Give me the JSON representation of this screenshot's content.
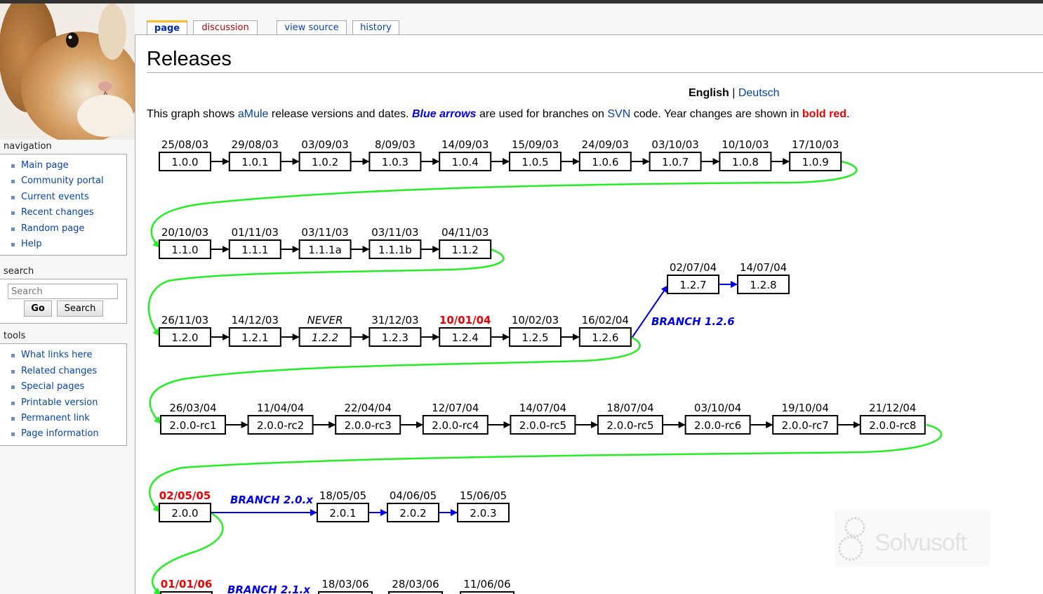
{
  "page": {
    "title": "Releases",
    "tabs": {
      "page": "page",
      "discussion": "discussion",
      "view_source": "view source",
      "history": "history"
    },
    "lang": {
      "english": "English",
      "separator": "|",
      "deutsch": "Deutsch"
    },
    "intro": {
      "p1": "This graph shows ",
      "amule": "aMule",
      "p2": " release versions and dates. ",
      "blue_arrows": "Blue arrows",
      "p3": " are used for branches on ",
      "svn": "SVN",
      "p4": " code. Year changes are shown in ",
      "bold_red": "bold red",
      "p5": "."
    }
  },
  "sidebar": {
    "navigation": {
      "heading": "navigation",
      "items": [
        "Main page",
        "Community portal",
        "Current events",
        "Recent changes",
        "Random page",
        "Help"
      ]
    },
    "search": {
      "heading": "search",
      "placeholder": "Search",
      "go": "Go",
      "search": "Search"
    },
    "tools": {
      "heading": "tools",
      "items": [
        "What links here",
        "Related changes",
        "Special pages",
        "Printable version",
        "Permanent link",
        "Page information"
      ]
    }
  },
  "watermark": {
    "text": "Solvusoft"
  },
  "colors": {
    "link": "#0645ad",
    "branch": "#0000ee",
    "year_change": "#ee0000",
    "wrap_arrow": "#22ee22"
  },
  "graph": {
    "rows": [
      {
        "nodes": [
          {
            "v": "1.0.0",
            "d": "25/08/03"
          },
          {
            "v": "1.0.1",
            "d": "29/08/03"
          },
          {
            "v": "1.0.2",
            "d": "03/09/03"
          },
          {
            "v": "1.0.3",
            "d": "8/09/03"
          },
          {
            "v": "1.0.4",
            "d": "14/09/03"
          },
          {
            "v": "1.0.5",
            "d": "15/09/03"
          },
          {
            "v": "1.0.6",
            "d": "24/09/03"
          },
          {
            "v": "1.0.7",
            "d": "03/10/03"
          },
          {
            "v": "1.0.8",
            "d": "10/10/03"
          },
          {
            "v": "1.0.9",
            "d": "17/10/03"
          }
        ]
      },
      {
        "nodes": [
          {
            "v": "1.1.0",
            "d": "20/10/03"
          },
          {
            "v": "1.1.1",
            "d": "01/11/03"
          },
          {
            "v": "1.1.1a",
            "d": "03/11/03"
          },
          {
            "v": "1.1.1b",
            "d": "03/11/03"
          },
          {
            "v": "1.1.2",
            "d": "04/11/03"
          }
        ]
      },
      {
        "nodes": [
          {
            "v": "1.2.0",
            "d": "26/11/03"
          },
          {
            "v": "1.2.1",
            "d": "14/12/03"
          },
          {
            "v": "1.2.2",
            "d": "NEVER",
            "italic": true
          },
          {
            "v": "1.2.3",
            "d": "31/12/03"
          },
          {
            "v": "1.2.4",
            "d": "10/01/04",
            "year": true
          },
          {
            "v": "1.2.5",
            "d": "10/02/03"
          },
          {
            "v": "1.2.6",
            "d": "16/02/04"
          }
        ]
      },
      {
        "nodes": [
          {
            "v": "2.0.0-rc1",
            "d": "26/03/04"
          },
          {
            "v": "2.0.0-rc2",
            "d": "11/04/04"
          },
          {
            "v": "2.0.0-rc3",
            "d": "22/04/04"
          },
          {
            "v": "2.0.0-rc4",
            "d": "12/07/04"
          },
          {
            "v": "2.0.0-rc5",
            "d": "14/07/04"
          },
          {
            "v": "2.0.0-rc5",
            "d": "18/07/04"
          },
          {
            "v": "2.0.0-rc6",
            "d": "03/10/04"
          },
          {
            "v": "2.0.0-rc7",
            "d": "19/10/04"
          },
          {
            "v": "2.0.0-rc8",
            "d": "21/12/04"
          }
        ]
      },
      {
        "nodes": [
          {
            "v": "2.0.0",
            "d": "02/05/05",
            "year": true
          }
        ]
      },
      {
        "nodes": [
          {
            "v": "",
            "d": "01/01/06",
            "year": true
          }
        ]
      }
    ],
    "branch_126": {
      "label": "BRANCH 1.2.6",
      "nodes": [
        {
          "v": "1.2.7",
          "d": "02/07/04"
        },
        {
          "v": "1.2.8",
          "d": "14/07/04"
        }
      ]
    },
    "branch_20x": {
      "label": "BRANCH 2.0.x",
      "nodes": [
        {
          "v": "2.0.1",
          "d": "18/05/05"
        },
        {
          "v": "2.0.2",
          "d": "04/06/05"
        },
        {
          "v": "2.0.3",
          "d": "15/06/05"
        }
      ]
    },
    "branch_21x": {
      "label": "BRANCH 2.1.x",
      "dates": [
        "18/03/06",
        "28/03/06",
        "11/06/06"
      ]
    }
  }
}
